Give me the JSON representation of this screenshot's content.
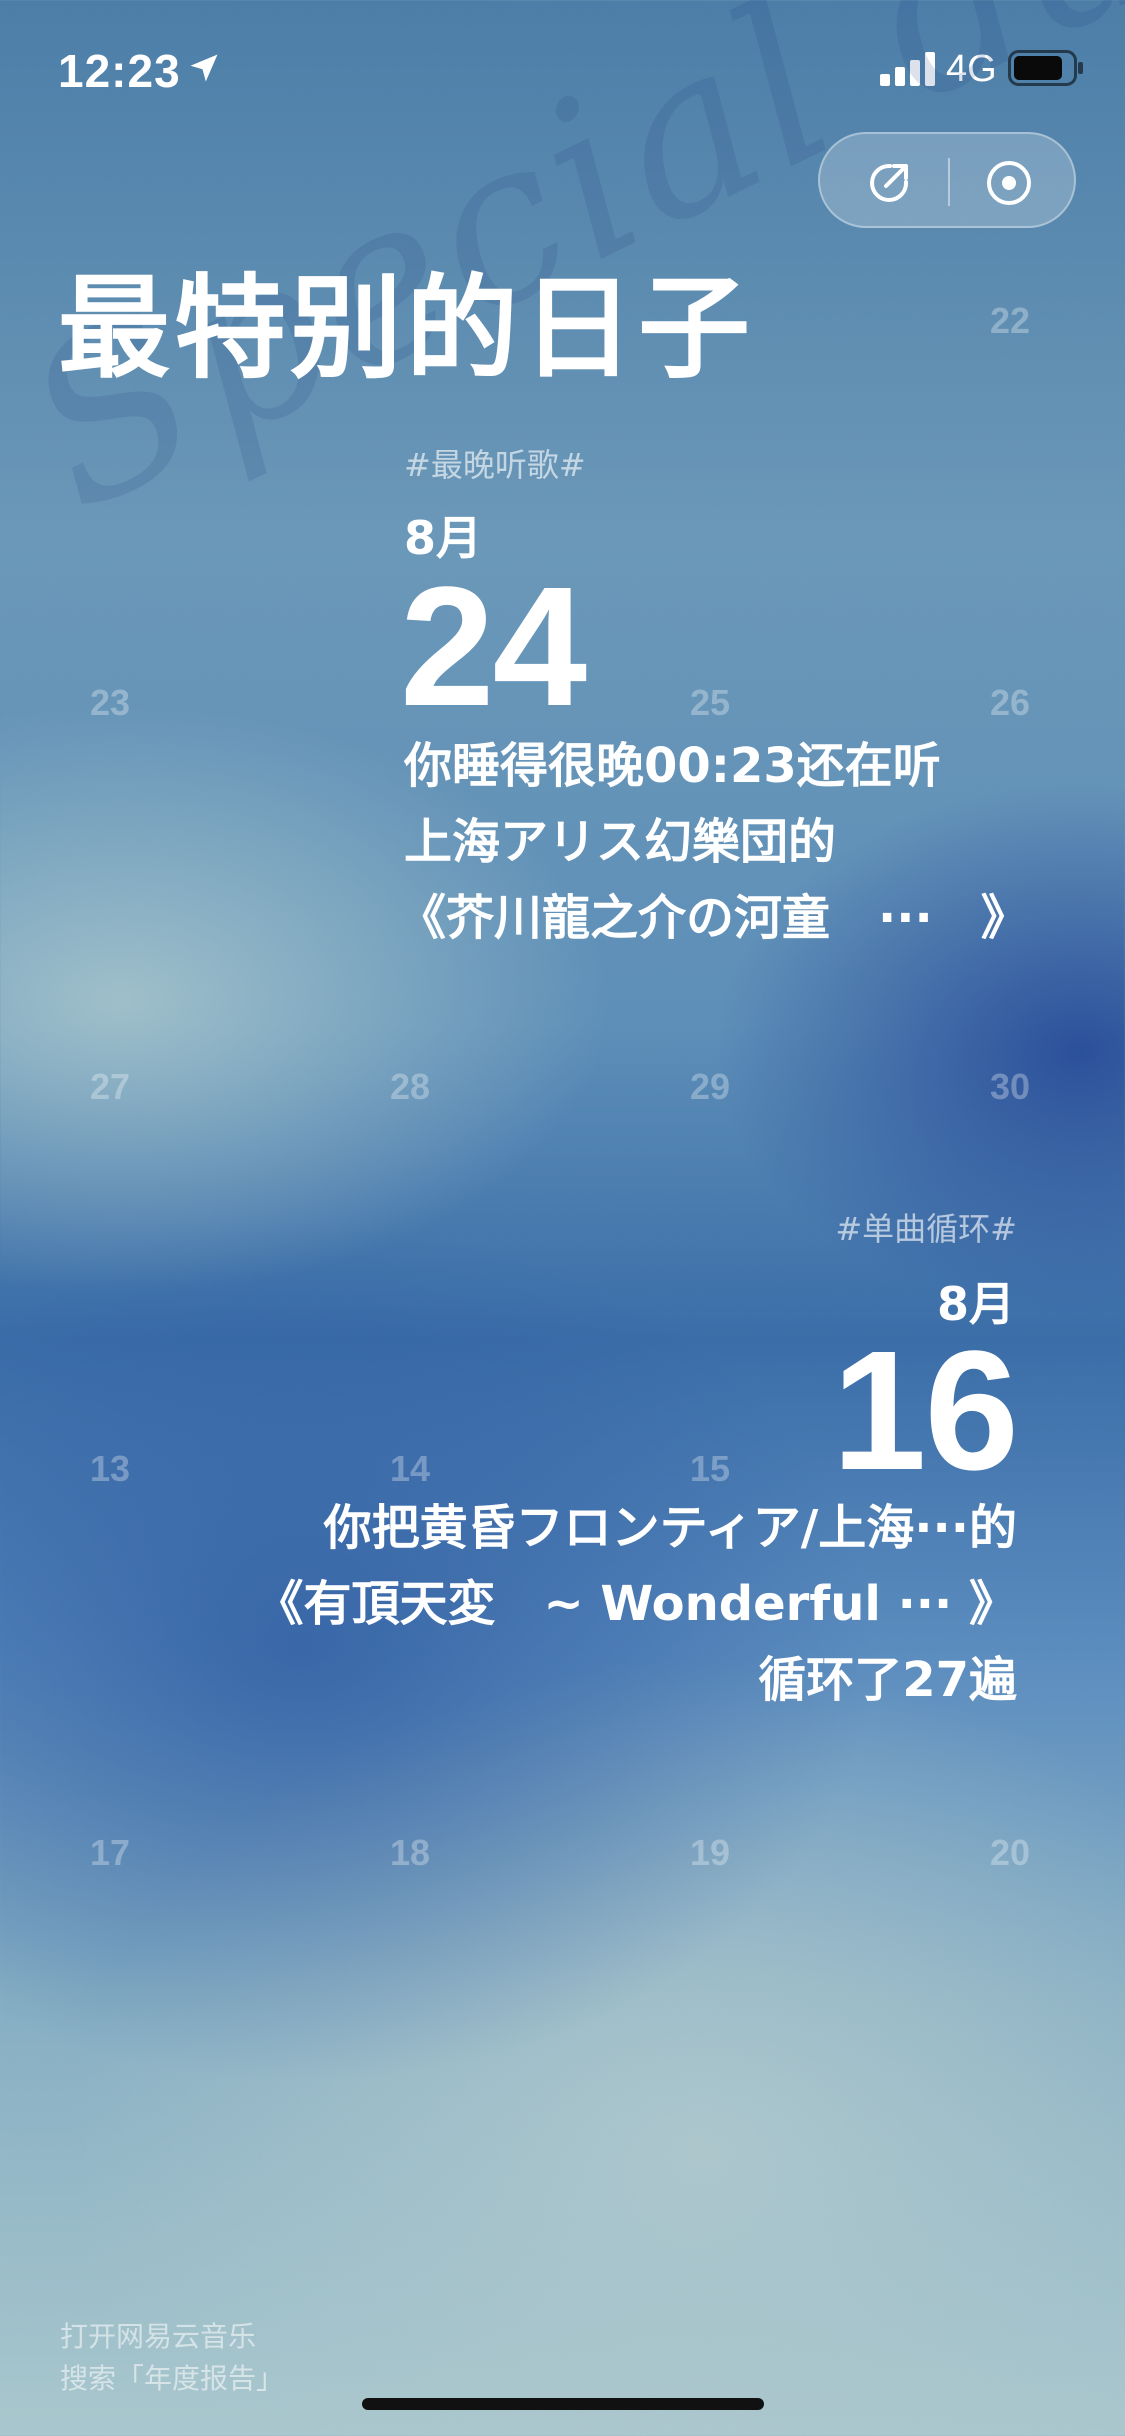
{
  "status_bar": {
    "time": "12:23",
    "network": "4G"
  },
  "watermark": "Special day",
  "title": "最特别的日子",
  "calendar_numbers": [
    {
      "label": "22"
    },
    {
      "label": "23"
    },
    {
      "label": "25"
    },
    {
      "label": "26"
    },
    {
      "label": "27"
    },
    {
      "label": "28"
    },
    {
      "label": "29"
    },
    {
      "label": "30"
    },
    {
      "label": "13"
    },
    {
      "label": "14"
    },
    {
      "label": "15"
    },
    {
      "label": "17"
    },
    {
      "label": "18"
    },
    {
      "label": "19"
    },
    {
      "label": "20"
    }
  ],
  "latest_listen": {
    "tag": "#最晚听歌#",
    "month": "8月",
    "day": "24",
    "lines": [
      "你睡得很晚00:23还在听",
      "上海アリス幻樂団的",
      "《芥川龍之介の河童　···　》"
    ]
  },
  "single_loop": {
    "tag": "#单曲循环#",
    "month": "8月",
    "day": "16",
    "lines": [
      "你把黄昏フロンティア/上海···的",
      "《有頂天変　~ Wonderful ··· 》",
      "循环了27遍"
    ]
  },
  "footer": {
    "line1": "打开网易云音乐",
    "line2": "搜索「年度报告」"
  },
  "icons": {
    "location": "location-arrow-icon",
    "signal": "signal-bars-icon",
    "battery": "battery-icon",
    "share": "share-icon",
    "target": "target-icon"
  }
}
